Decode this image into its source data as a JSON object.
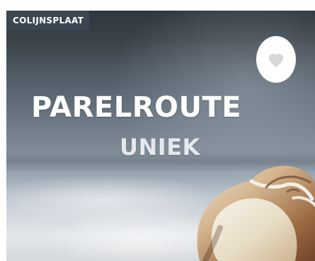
{
  "card": {
    "location": "COLIJNSPLAAT",
    "title": "PARELROUTE",
    "subtitle": "UNIEK",
    "favorite_icon": "heart-icon"
  },
  "colors": {
    "badge_background": "#3c4652",
    "favorite_background": "#ffffff",
    "heart_fill": "#d7d7d7"
  }
}
